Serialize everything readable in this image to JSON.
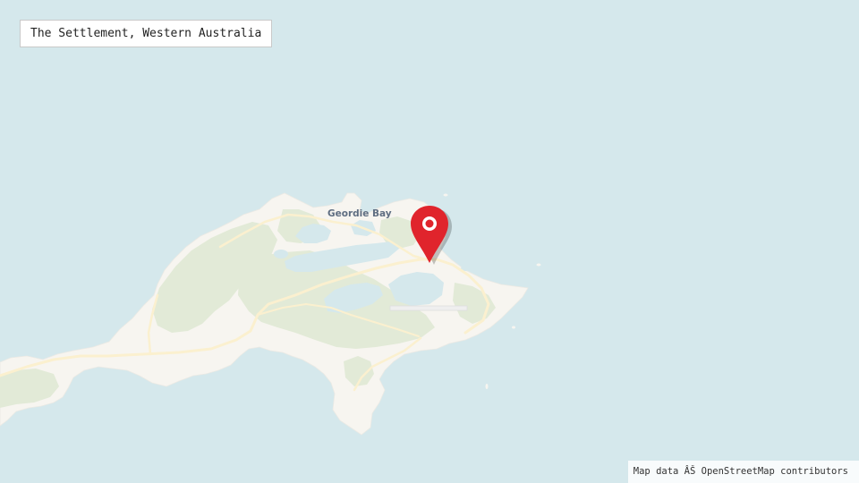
{
  "map": {
    "title": "The Settlement, Western Australia",
    "attribution": "Map data ÂŠ OpenStreetMap contributors",
    "place_labels": {
      "geordie_bay": "Geordie Bay"
    },
    "marker": {
      "color": "#e0242c"
    },
    "colors": {
      "water": "#d5e8ec",
      "land": "#f7f5f0",
      "vegetation": "#e2ead7",
      "lake": "#d5e8ec",
      "road": "#fbf0cf"
    }
  }
}
